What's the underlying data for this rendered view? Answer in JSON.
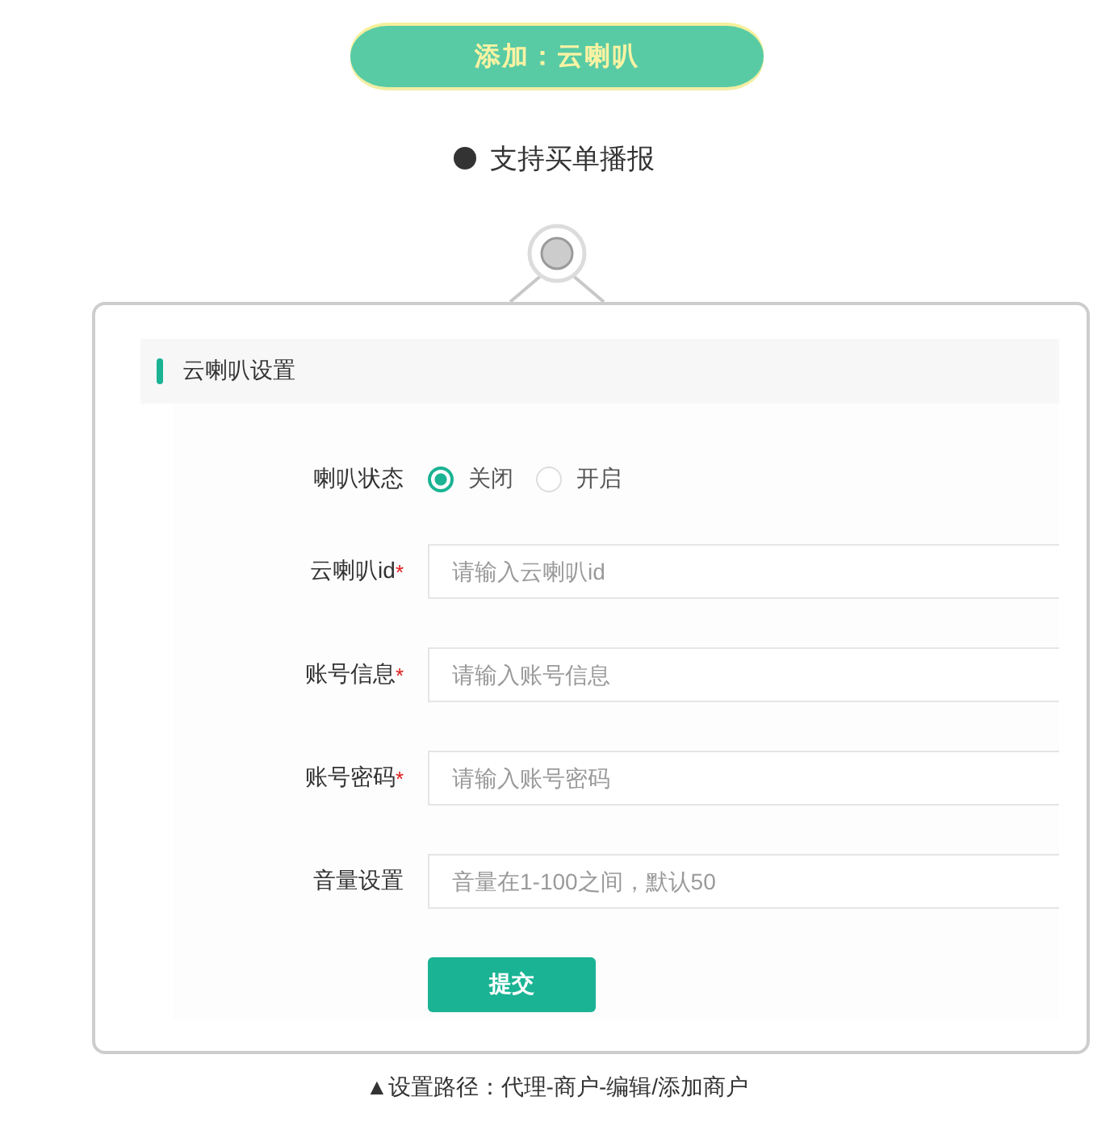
{
  "banner": {
    "title": "添加：云喇叭"
  },
  "feature": {
    "text": "支持买单播报"
  },
  "card": {
    "section_title": "云喇叭设置",
    "status_field": {
      "label": "喇叭状态",
      "options": [
        {
          "label": "关闭",
          "selected": true
        },
        {
          "label": "开启",
          "selected": false
        }
      ]
    },
    "fields": [
      {
        "label": "云喇叭id",
        "required_mark": "*",
        "placeholder": "请输入云喇叭id"
      },
      {
        "label": "账号信息",
        "required_mark": "*",
        "placeholder": "请输入账号信息"
      },
      {
        "label": "账号密码",
        "required_mark": "*",
        "placeholder": "请输入账号密码"
      },
      {
        "label": "音量设置",
        "placeholder": "音量在1-100之间，默认50"
      }
    ],
    "submit_button": "提交"
  },
  "caption": "▲设置路径：代理-商户-编辑/添加商户"
}
